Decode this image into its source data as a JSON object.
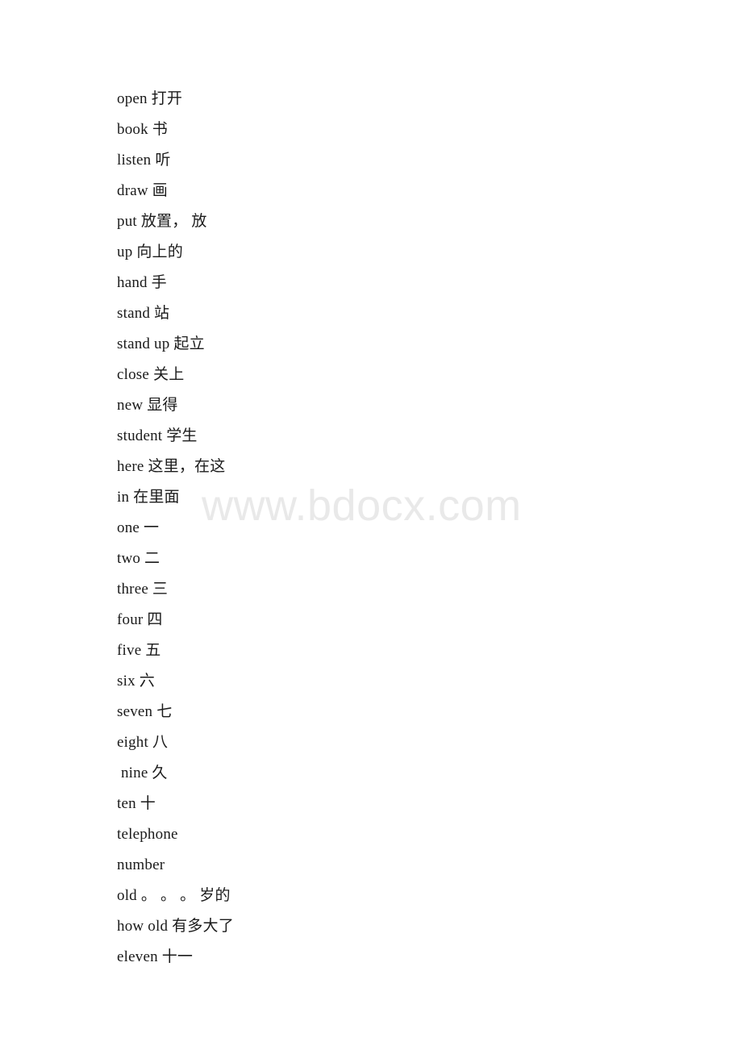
{
  "document": {
    "type": "vocabulary-word-list",
    "page_background": "#ffffff",
    "text_color": "#1b1b1b"
  },
  "watermark": {
    "text": "www.bdocx.com",
    "color": "#e9e9e9"
  },
  "entries": [
    {
      "line": "open 打开"
    },
    {
      "line": "book 书"
    },
    {
      "line": "listen 听"
    },
    {
      "line": "draw 画"
    },
    {
      "line": "put 放置， 放"
    },
    {
      "line": "up 向上的"
    },
    {
      "line": "hand 手"
    },
    {
      "line": "stand 站"
    },
    {
      "line": "stand up 起立"
    },
    {
      "line": "close 关上"
    },
    {
      "line": "new 显得"
    },
    {
      "line": "student 学生"
    },
    {
      "line": "here 这里，在这"
    },
    {
      "line": "in 在里面"
    },
    {
      "line": "one 一"
    },
    {
      "line": "two 二"
    },
    {
      "line": "three 三"
    },
    {
      "line": "four 四"
    },
    {
      "line": "five 五"
    },
    {
      "line": "six 六"
    },
    {
      "line": "seven 七"
    },
    {
      "line": "eight 八"
    },
    {
      "line": " nine 久"
    },
    {
      "line": "ten 十"
    },
    {
      "line": "telephone"
    },
    {
      "line": "number"
    },
    {
      "line": "old 。 。 。 岁的"
    },
    {
      "line": "how old 有多大了"
    },
    {
      "line": "eleven 十一"
    }
  ]
}
